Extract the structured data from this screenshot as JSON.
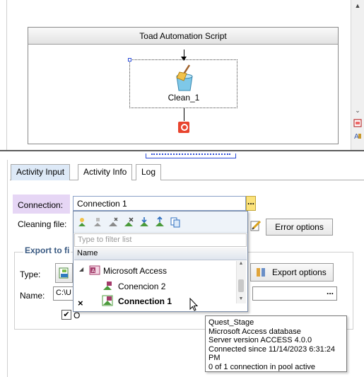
{
  "designer": {
    "script_title": "Toad Automation Script",
    "activity_label": "Clean_1"
  },
  "tabs": [
    {
      "label": "Activity Input",
      "active": true
    },
    {
      "label": "Activity Info",
      "active": false
    },
    {
      "label": "Log",
      "active": false
    }
  ],
  "form": {
    "connection_label": "Connection:",
    "connection_value": "Connection 1",
    "connection_button": "...",
    "cleaning_file_label": "Cleaning file:",
    "error_options_button": "Error options",
    "export_group_title": "Export to fi",
    "type_label": "Type:",
    "export_options_button": "Export options",
    "name_label": "Name:",
    "name_value": "C:\\U",
    "name_button": "...",
    "checkbox_label": "O",
    "checkbox_checked": true
  },
  "dropdown": {
    "filter_placeholder": "Type to filter list",
    "column_header": "Name",
    "group": "Microsoft Access",
    "items": [
      {
        "label": "Conencion 2",
        "bold": false
      },
      {
        "label": "Connection 1",
        "bold": true
      }
    ],
    "close_glyph": "×"
  },
  "tooltip": {
    "lines": [
      "Quest_Stage",
      "Microsoft Access database",
      "Server version ACCESS 4.0.0",
      "Connected since 11/14/2023 6:31:24 PM",
      "0 of 1 connection in pool active"
    ]
  },
  "colors": {
    "tab_active_bg": "#dde9f7",
    "connection_label_highlight": "#e6d6f5",
    "ellipsis_button": "#fbe27a",
    "stop_icon": "#e8442e",
    "group_title": "#3a5a82"
  }
}
